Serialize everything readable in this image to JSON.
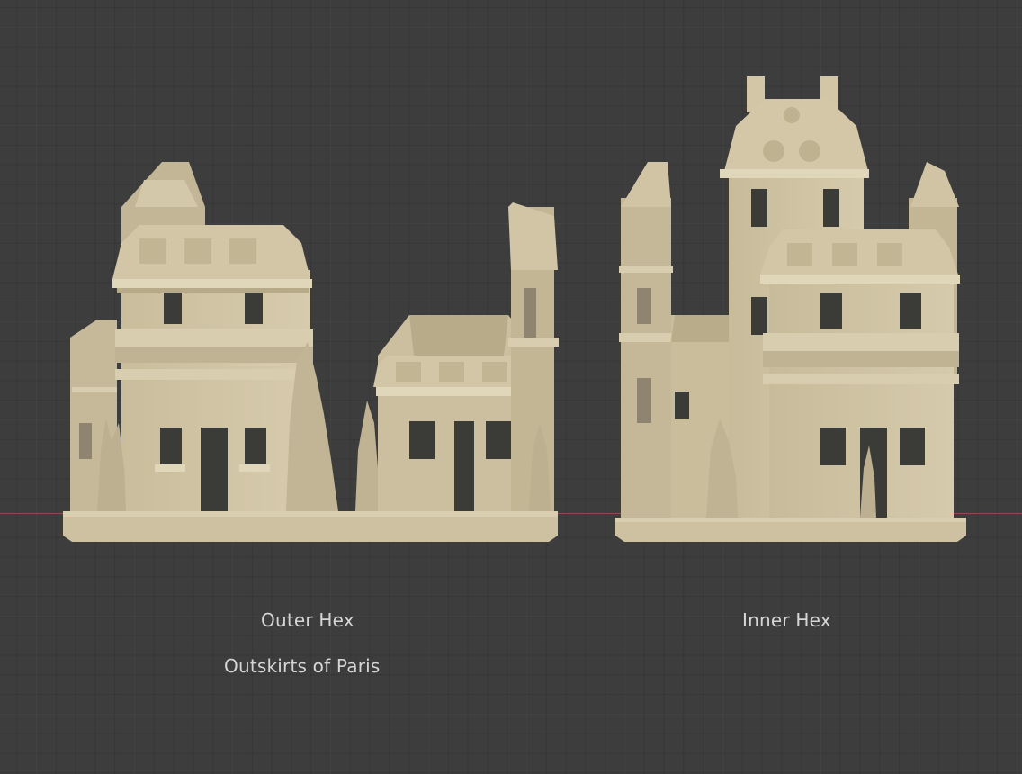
{
  "viewport": {
    "background": "#3d3d3d",
    "x_axis_color": "#9a4650",
    "model_color": "#cfc3a3"
  },
  "labels": {
    "outer_hex": "Outer Hex",
    "outskirts": "Outskirts of Paris",
    "inner_hex": "Inner Hex"
  },
  "models": [
    {
      "name": "outer-hex-model",
      "description_icon": "building-model-icon"
    },
    {
      "name": "inner-hex-model",
      "description_icon": "building-model-icon"
    }
  ]
}
